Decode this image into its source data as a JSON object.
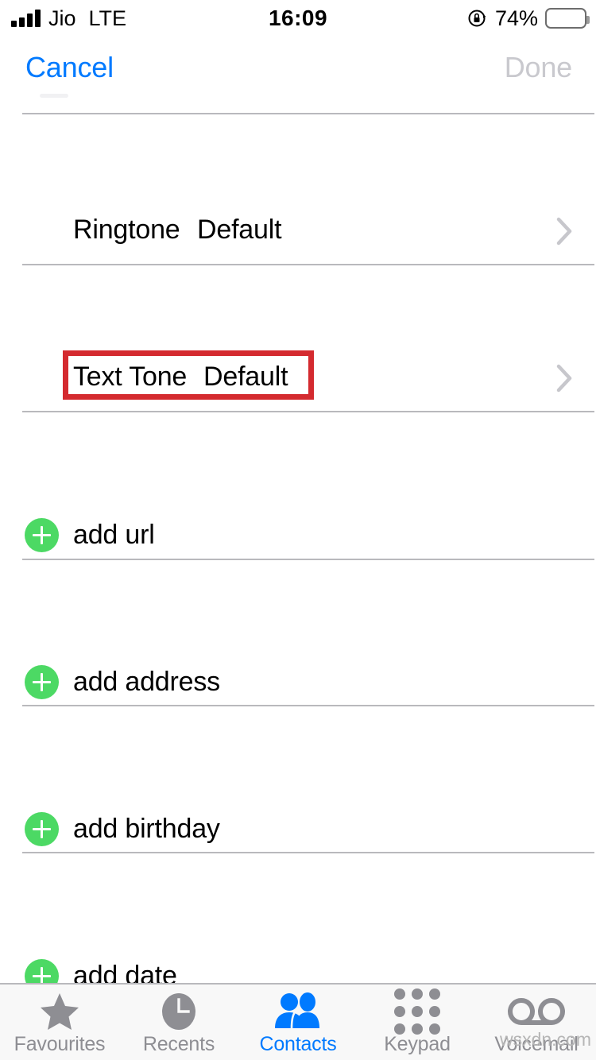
{
  "status_bar": {
    "carrier": "Jio",
    "network": "LTE",
    "time": "16:09",
    "battery_percent": "74%",
    "battery_level": 74,
    "signal_bars": 4,
    "rotation_lock_icon": "rotation-lock-icon"
  },
  "nav_bar": {
    "cancel_label": "Cancel",
    "done_label": "Done",
    "cancel_color": "#007aff",
    "done_color": "#c9c9ce"
  },
  "rows": [
    {
      "type": "disclosure",
      "label": "Ringtone",
      "value": "Default",
      "chevron": true
    },
    {
      "type": "disclosure",
      "label": "Text Tone",
      "value": "Default",
      "chevron": true,
      "highlighted": true
    },
    {
      "type": "add",
      "label": "add url"
    },
    {
      "type": "add",
      "label": "add address"
    },
    {
      "type": "add",
      "label": "add birthday"
    },
    {
      "type": "add",
      "label": "add date"
    }
  ],
  "annotation": {
    "target": "Text Tone",
    "color": "#d42a2f",
    "shape": "rectangle-outline"
  },
  "tab_bar": {
    "items": [
      {
        "label": "Favourites",
        "icon": "star-icon",
        "active": false
      },
      {
        "label": "Recents",
        "icon": "clock-icon",
        "active": false
      },
      {
        "label": "Contacts",
        "icon": "contacts-icon",
        "active": true
      },
      {
        "label": "Keypad",
        "icon": "keypad-icon",
        "active": false
      },
      {
        "label": "Voicemail",
        "icon": "voicemail-icon",
        "active": false
      }
    ],
    "active_color": "#007aff",
    "inactive_color": "#8e8e93"
  },
  "watermark": {
    "text": "wsxdn.com"
  },
  "colors": {
    "add_button_green": "#4cd964",
    "separator": "#b9b9bd",
    "background": "#ffffff",
    "tabbar_background": "#f8f8f8"
  }
}
